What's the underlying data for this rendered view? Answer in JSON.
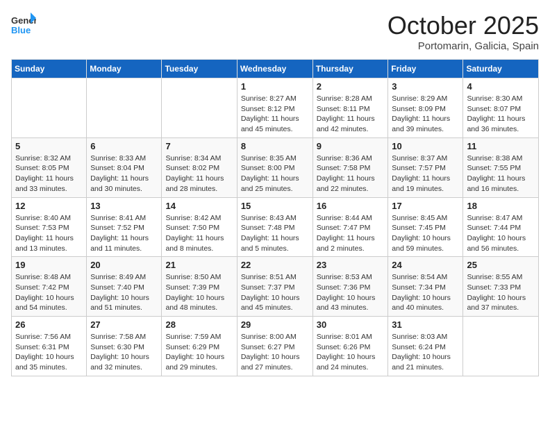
{
  "header": {
    "logo_general": "General",
    "logo_blue": "Blue",
    "month_title": "October 2025",
    "location": "Portomarin, Galicia, Spain"
  },
  "weekdays": [
    "Sunday",
    "Monday",
    "Tuesday",
    "Wednesday",
    "Thursday",
    "Friday",
    "Saturday"
  ],
  "weeks": [
    [
      {
        "day": "",
        "sunrise": "",
        "sunset": "",
        "daylight": ""
      },
      {
        "day": "",
        "sunrise": "",
        "sunset": "",
        "daylight": ""
      },
      {
        "day": "",
        "sunrise": "",
        "sunset": "",
        "daylight": ""
      },
      {
        "day": "1",
        "sunrise": "Sunrise: 8:27 AM",
        "sunset": "Sunset: 8:12 PM",
        "daylight": "Daylight: 11 hours and 45 minutes."
      },
      {
        "day": "2",
        "sunrise": "Sunrise: 8:28 AM",
        "sunset": "Sunset: 8:11 PM",
        "daylight": "Daylight: 11 hours and 42 minutes."
      },
      {
        "day": "3",
        "sunrise": "Sunrise: 8:29 AM",
        "sunset": "Sunset: 8:09 PM",
        "daylight": "Daylight: 11 hours and 39 minutes."
      },
      {
        "day": "4",
        "sunrise": "Sunrise: 8:30 AM",
        "sunset": "Sunset: 8:07 PM",
        "daylight": "Daylight: 11 hours and 36 minutes."
      }
    ],
    [
      {
        "day": "5",
        "sunrise": "Sunrise: 8:32 AM",
        "sunset": "Sunset: 8:05 PM",
        "daylight": "Daylight: 11 hours and 33 minutes."
      },
      {
        "day": "6",
        "sunrise": "Sunrise: 8:33 AM",
        "sunset": "Sunset: 8:04 PM",
        "daylight": "Daylight: 11 hours and 30 minutes."
      },
      {
        "day": "7",
        "sunrise": "Sunrise: 8:34 AM",
        "sunset": "Sunset: 8:02 PM",
        "daylight": "Daylight: 11 hours and 28 minutes."
      },
      {
        "day": "8",
        "sunrise": "Sunrise: 8:35 AM",
        "sunset": "Sunset: 8:00 PM",
        "daylight": "Daylight: 11 hours and 25 minutes."
      },
      {
        "day": "9",
        "sunrise": "Sunrise: 8:36 AM",
        "sunset": "Sunset: 7:58 PM",
        "daylight": "Daylight: 11 hours and 22 minutes."
      },
      {
        "day": "10",
        "sunrise": "Sunrise: 8:37 AM",
        "sunset": "Sunset: 7:57 PM",
        "daylight": "Daylight: 11 hours and 19 minutes."
      },
      {
        "day": "11",
        "sunrise": "Sunrise: 8:38 AM",
        "sunset": "Sunset: 7:55 PM",
        "daylight": "Daylight: 11 hours and 16 minutes."
      }
    ],
    [
      {
        "day": "12",
        "sunrise": "Sunrise: 8:40 AM",
        "sunset": "Sunset: 7:53 PM",
        "daylight": "Daylight: 11 hours and 13 minutes."
      },
      {
        "day": "13",
        "sunrise": "Sunrise: 8:41 AM",
        "sunset": "Sunset: 7:52 PM",
        "daylight": "Daylight: 11 hours and 11 minutes."
      },
      {
        "day": "14",
        "sunrise": "Sunrise: 8:42 AM",
        "sunset": "Sunset: 7:50 PM",
        "daylight": "Daylight: 11 hours and 8 minutes."
      },
      {
        "day": "15",
        "sunrise": "Sunrise: 8:43 AM",
        "sunset": "Sunset: 7:48 PM",
        "daylight": "Daylight: 11 hours and 5 minutes."
      },
      {
        "day": "16",
        "sunrise": "Sunrise: 8:44 AM",
        "sunset": "Sunset: 7:47 PM",
        "daylight": "Daylight: 11 hours and 2 minutes."
      },
      {
        "day": "17",
        "sunrise": "Sunrise: 8:45 AM",
        "sunset": "Sunset: 7:45 PM",
        "daylight": "Daylight: 10 hours and 59 minutes."
      },
      {
        "day": "18",
        "sunrise": "Sunrise: 8:47 AM",
        "sunset": "Sunset: 7:44 PM",
        "daylight": "Daylight: 10 hours and 56 minutes."
      }
    ],
    [
      {
        "day": "19",
        "sunrise": "Sunrise: 8:48 AM",
        "sunset": "Sunset: 7:42 PM",
        "daylight": "Daylight: 10 hours and 54 minutes."
      },
      {
        "day": "20",
        "sunrise": "Sunrise: 8:49 AM",
        "sunset": "Sunset: 7:40 PM",
        "daylight": "Daylight: 10 hours and 51 minutes."
      },
      {
        "day": "21",
        "sunrise": "Sunrise: 8:50 AM",
        "sunset": "Sunset: 7:39 PM",
        "daylight": "Daylight: 10 hours and 48 minutes."
      },
      {
        "day": "22",
        "sunrise": "Sunrise: 8:51 AM",
        "sunset": "Sunset: 7:37 PM",
        "daylight": "Daylight: 10 hours and 45 minutes."
      },
      {
        "day": "23",
        "sunrise": "Sunrise: 8:53 AM",
        "sunset": "Sunset: 7:36 PM",
        "daylight": "Daylight: 10 hours and 43 minutes."
      },
      {
        "day": "24",
        "sunrise": "Sunrise: 8:54 AM",
        "sunset": "Sunset: 7:34 PM",
        "daylight": "Daylight: 10 hours and 40 minutes."
      },
      {
        "day": "25",
        "sunrise": "Sunrise: 8:55 AM",
        "sunset": "Sunset: 7:33 PM",
        "daylight": "Daylight: 10 hours and 37 minutes."
      }
    ],
    [
      {
        "day": "26",
        "sunrise": "Sunrise: 7:56 AM",
        "sunset": "Sunset: 6:31 PM",
        "daylight": "Daylight: 10 hours and 35 minutes."
      },
      {
        "day": "27",
        "sunrise": "Sunrise: 7:58 AM",
        "sunset": "Sunset: 6:30 PM",
        "daylight": "Daylight: 10 hours and 32 minutes."
      },
      {
        "day": "28",
        "sunrise": "Sunrise: 7:59 AM",
        "sunset": "Sunset: 6:29 PM",
        "daylight": "Daylight: 10 hours and 29 minutes."
      },
      {
        "day": "29",
        "sunrise": "Sunrise: 8:00 AM",
        "sunset": "Sunset: 6:27 PM",
        "daylight": "Daylight: 10 hours and 27 minutes."
      },
      {
        "day": "30",
        "sunrise": "Sunrise: 8:01 AM",
        "sunset": "Sunset: 6:26 PM",
        "daylight": "Daylight: 10 hours and 24 minutes."
      },
      {
        "day": "31",
        "sunrise": "Sunrise: 8:03 AM",
        "sunset": "Sunset: 6:24 PM",
        "daylight": "Daylight: 10 hours and 21 minutes."
      },
      {
        "day": "",
        "sunrise": "",
        "sunset": "",
        "daylight": ""
      }
    ]
  ]
}
